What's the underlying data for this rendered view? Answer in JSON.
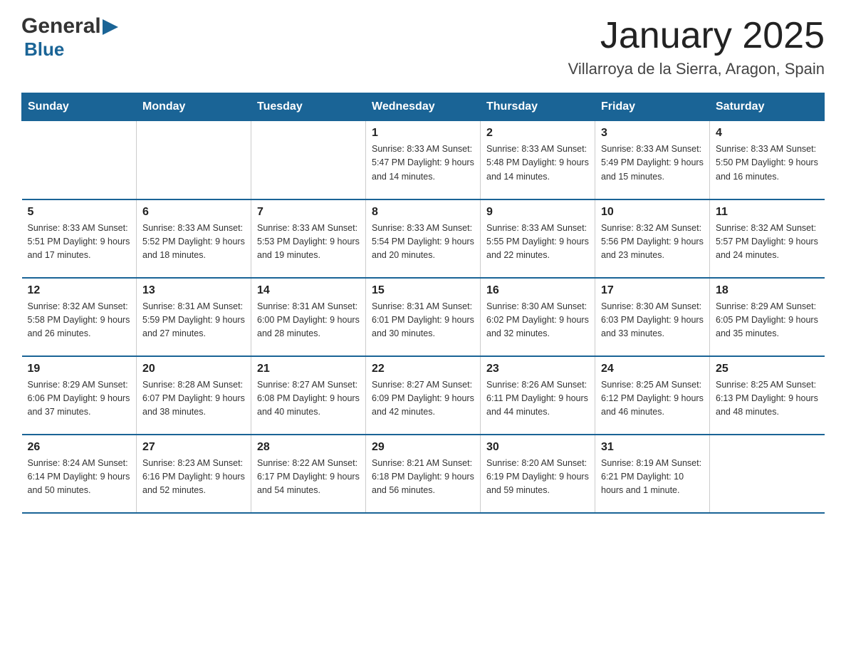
{
  "header": {
    "logo_general": "General",
    "logo_blue": "Blue",
    "title": "January 2025",
    "subtitle": "Villarroya de la Sierra, Aragon, Spain"
  },
  "days_of_week": [
    "Sunday",
    "Monday",
    "Tuesday",
    "Wednesday",
    "Thursday",
    "Friday",
    "Saturday"
  ],
  "weeks": [
    [
      {
        "day": "",
        "info": ""
      },
      {
        "day": "",
        "info": ""
      },
      {
        "day": "",
        "info": ""
      },
      {
        "day": "1",
        "info": "Sunrise: 8:33 AM\nSunset: 5:47 PM\nDaylight: 9 hours\nand 14 minutes."
      },
      {
        "day": "2",
        "info": "Sunrise: 8:33 AM\nSunset: 5:48 PM\nDaylight: 9 hours\nand 14 minutes."
      },
      {
        "day": "3",
        "info": "Sunrise: 8:33 AM\nSunset: 5:49 PM\nDaylight: 9 hours\nand 15 minutes."
      },
      {
        "day": "4",
        "info": "Sunrise: 8:33 AM\nSunset: 5:50 PM\nDaylight: 9 hours\nand 16 minutes."
      }
    ],
    [
      {
        "day": "5",
        "info": "Sunrise: 8:33 AM\nSunset: 5:51 PM\nDaylight: 9 hours\nand 17 minutes."
      },
      {
        "day": "6",
        "info": "Sunrise: 8:33 AM\nSunset: 5:52 PM\nDaylight: 9 hours\nand 18 minutes."
      },
      {
        "day": "7",
        "info": "Sunrise: 8:33 AM\nSunset: 5:53 PM\nDaylight: 9 hours\nand 19 minutes."
      },
      {
        "day": "8",
        "info": "Sunrise: 8:33 AM\nSunset: 5:54 PM\nDaylight: 9 hours\nand 20 minutes."
      },
      {
        "day": "9",
        "info": "Sunrise: 8:33 AM\nSunset: 5:55 PM\nDaylight: 9 hours\nand 22 minutes."
      },
      {
        "day": "10",
        "info": "Sunrise: 8:32 AM\nSunset: 5:56 PM\nDaylight: 9 hours\nand 23 minutes."
      },
      {
        "day": "11",
        "info": "Sunrise: 8:32 AM\nSunset: 5:57 PM\nDaylight: 9 hours\nand 24 minutes."
      }
    ],
    [
      {
        "day": "12",
        "info": "Sunrise: 8:32 AM\nSunset: 5:58 PM\nDaylight: 9 hours\nand 26 minutes."
      },
      {
        "day": "13",
        "info": "Sunrise: 8:31 AM\nSunset: 5:59 PM\nDaylight: 9 hours\nand 27 minutes."
      },
      {
        "day": "14",
        "info": "Sunrise: 8:31 AM\nSunset: 6:00 PM\nDaylight: 9 hours\nand 28 minutes."
      },
      {
        "day": "15",
        "info": "Sunrise: 8:31 AM\nSunset: 6:01 PM\nDaylight: 9 hours\nand 30 minutes."
      },
      {
        "day": "16",
        "info": "Sunrise: 8:30 AM\nSunset: 6:02 PM\nDaylight: 9 hours\nand 32 minutes."
      },
      {
        "day": "17",
        "info": "Sunrise: 8:30 AM\nSunset: 6:03 PM\nDaylight: 9 hours\nand 33 minutes."
      },
      {
        "day": "18",
        "info": "Sunrise: 8:29 AM\nSunset: 6:05 PM\nDaylight: 9 hours\nand 35 minutes."
      }
    ],
    [
      {
        "day": "19",
        "info": "Sunrise: 8:29 AM\nSunset: 6:06 PM\nDaylight: 9 hours\nand 37 minutes."
      },
      {
        "day": "20",
        "info": "Sunrise: 8:28 AM\nSunset: 6:07 PM\nDaylight: 9 hours\nand 38 minutes."
      },
      {
        "day": "21",
        "info": "Sunrise: 8:27 AM\nSunset: 6:08 PM\nDaylight: 9 hours\nand 40 minutes."
      },
      {
        "day": "22",
        "info": "Sunrise: 8:27 AM\nSunset: 6:09 PM\nDaylight: 9 hours\nand 42 minutes."
      },
      {
        "day": "23",
        "info": "Sunrise: 8:26 AM\nSunset: 6:11 PM\nDaylight: 9 hours\nand 44 minutes."
      },
      {
        "day": "24",
        "info": "Sunrise: 8:25 AM\nSunset: 6:12 PM\nDaylight: 9 hours\nand 46 minutes."
      },
      {
        "day": "25",
        "info": "Sunrise: 8:25 AM\nSunset: 6:13 PM\nDaylight: 9 hours\nand 48 minutes."
      }
    ],
    [
      {
        "day": "26",
        "info": "Sunrise: 8:24 AM\nSunset: 6:14 PM\nDaylight: 9 hours\nand 50 minutes."
      },
      {
        "day": "27",
        "info": "Sunrise: 8:23 AM\nSunset: 6:16 PM\nDaylight: 9 hours\nand 52 minutes."
      },
      {
        "day": "28",
        "info": "Sunrise: 8:22 AM\nSunset: 6:17 PM\nDaylight: 9 hours\nand 54 minutes."
      },
      {
        "day": "29",
        "info": "Sunrise: 8:21 AM\nSunset: 6:18 PM\nDaylight: 9 hours\nand 56 minutes."
      },
      {
        "day": "30",
        "info": "Sunrise: 8:20 AM\nSunset: 6:19 PM\nDaylight: 9 hours\nand 59 minutes."
      },
      {
        "day": "31",
        "info": "Sunrise: 8:19 AM\nSunset: 6:21 PM\nDaylight: 10 hours\nand 1 minute."
      },
      {
        "day": "",
        "info": ""
      }
    ]
  ]
}
